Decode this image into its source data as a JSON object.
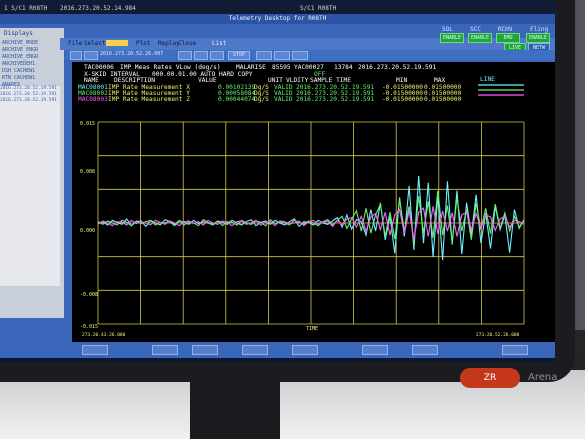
{
  "top_banner": {
    "left": "1  S/C1  R08TH",
    "mid": "2016.273.20.52.14.984",
    "right_title": "S/C1  R08TH"
  },
  "window": {
    "title": "Telemetry Desktop for R08TH"
  },
  "menubar": {
    "items": [
      "File",
      "Select",
      "",
      "Plot",
      "Replay",
      "Close"
    ],
    "highlighted_index": 2,
    "list_label": "List",
    "subtabs_label": "Subtabs",
    "stop_label": "STOP"
  },
  "sidebar": {
    "title": "Displays",
    "items": [
      "ARCHIVE_MODE",
      "ARCHIVE ENGR",
      "ARCHIVE_ENGR",
      "ARCHIVEDEH1",
      "DSH CACHEW1",
      "RTN CACHEW1",
      "ANAREX"
    ]
  },
  "status_panel": {
    "labels": [
      "SOL",
      "SCC",
      "RCHV",
      "Fling"
    ],
    "buttons": [
      "ENABLE",
      "ENABLE",
      "EMU",
      "ENABLE",
      "LIVE",
      "NETW"
    ]
  },
  "toolbar": {
    "timestamp": "2016.273.20.52.26.007"
  },
  "plot": {
    "id_left": "TAC00006",
    "title": "IMP Meas Rates VLow (deg/s)",
    "malarise": "MALARISE",
    "num1": "85595",
    "id_right": "YAC00027",
    "num2": "13784",
    "time": "2016.273.20.52.19.591",
    "line_label": "LINE",
    "off_label": "OFF",
    "row_xskid": "X-SKID INTERVAL",
    "interval": "000.00.01.00 AUTO HARD COPY",
    "hdr_name": "NAME",
    "hdr_desc": "DESCRIPTION",
    "hdr_value": "VALUE",
    "hdr_unit": "UNIT",
    "hdr_valid": "VLDITY",
    "hdr_sample": "SAMPLE TIME",
    "hdr_min": "MIN",
    "hdr_max": "MAX",
    "rows": [
      {
        "name": "MAC08001",
        "desc": "IMP Rate Measurement X",
        "value": "0.00102139",
        "unit": "Dg/S",
        "valid": "VALID",
        "time": "2016.273.20.52.19.591",
        "min": "-0.01500000",
        "max": "0.01500000",
        "color": "#6ff0ff"
      },
      {
        "name": "MAC08002",
        "desc": "IMP Rate Measurement Y",
        "value": "0.00058084",
        "unit": "Dg/S",
        "valid": "VALID",
        "time": "2016.273.20.52.19.591",
        "min": "-0.01500000",
        "max": "0.01500000",
        "color": "#66f06a"
      },
      {
        "name": "MAC08003",
        "desc": "IMP Rate Measurement Z",
        "value": "0.00044074",
        "unit": "Dg/S",
        "valid": "VALID",
        "time": "2016.273.20.52.19.591",
        "min": "-0.01500000",
        "max": "0.01500000",
        "color": "#ff5cff"
      }
    ],
    "y_ticks": [
      "0.015",
      "0.008",
      "0.000",
      "-0.008",
      "-0.015"
    ],
    "x_start": "273.20.43.26.000",
    "x_label": "TIME",
    "x_end": "273.20.52.26.000"
  },
  "chart_data": {
    "type": "line",
    "title": "IMP Meas Rates VLow (deg/s)",
    "xlabel": "TIME",
    "ylabel": "",
    "ylim": [
      -0.015,
      0.015
    ],
    "x": [
      0,
      1,
      2,
      3,
      4,
      5,
      6,
      7,
      8,
      9,
      10,
      11,
      12,
      13,
      14,
      15,
      16,
      17,
      18,
      19,
      20,
      21,
      22,
      23,
      24,
      25,
      26,
      27,
      28,
      29,
      30,
      31,
      32,
      33,
      34,
      35,
      36,
      37,
      38,
      39,
      40,
      41,
      42,
      43,
      44,
      45,
      46,
      47,
      48,
      49,
      50,
      51,
      52,
      53,
      54,
      55,
      56,
      57,
      58,
      59,
      60,
      61,
      62,
      63,
      64,
      65,
      66,
      67,
      68,
      69,
      70,
      71,
      72,
      73,
      74,
      75,
      76,
      77,
      78,
      79,
      80,
      81,
      82,
      83,
      84,
      85,
      86,
      87,
      88,
      89
    ],
    "series": [
      {
        "name": "MAC08001",
        "color": "#6ff0ff",
        "values": [
          0.0,
          0.0002,
          -0.0003,
          0.0004,
          0.0001,
          -0.0002,
          0.0006,
          -0.0004,
          0.0002,
          0.0003,
          -0.0005,
          0.0004,
          0.0,
          -0.0003,
          0.0005,
          0.0002,
          -0.0004,
          0.0003,
          0.0001,
          -0.0002,
          0.0004,
          -0.0001,
          0.0002,
          0.0,
          -0.0003,
          0.0003,
          0.0001,
          -0.0002,
          0.0004,
          0.0,
          -0.0003,
          0.0002,
          0.0005,
          -0.0004,
          0.0001,
          0.0003,
          -0.0002,
          0.0004,
          0.0,
          -0.0003,
          0.0002,
          0.0006,
          -0.0005,
          0.0002,
          0.0001,
          -0.0003,
          0.0004,
          0.0,
          -0.0002,
          0.0003,
          0.0008,
          -0.0006,
          0.0012,
          -0.0009,
          0.0005,
          0.0002,
          -0.0018,
          0.002,
          -0.0012,
          0.003,
          -0.0025,
          0.001,
          -0.0045,
          0.0038,
          -0.002,
          0.0055,
          -0.004,
          0.007,
          -0.003,
          0.006,
          -0.005,
          0.004,
          -0.0055,
          0.0062,
          -0.0032,
          0.0048,
          -0.0046,
          0.003,
          -0.0018,
          0.0042,
          -0.003,
          0.0015,
          -0.0038,
          0.0025,
          -0.001,
          0.0012,
          -0.0044,
          0.002,
          -0.0008,
          0.0005
        ]
      },
      {
        "name": "MAC08002",
        "color": "#66f06a",
        "values": [
          0.0002,
          -0.0002,
          0.0003,
          0.0,
          -0.0003,
          0.0004,
          0.0001,
          -0.0004,
          0.0003,
          -0.0001,
          0.0002,
          0.0004,
          -0.0003,
          0.0001,
          0.0,
          0.0003,
          -0.0002,
          0.0004,
          -0.0003,
          0.0002,
          0.0,
          -0.0004,
          0.0005,
          0.0001,
          -0.0002,
          0.0003,
          -0.0004,
          0.0002,
          0.0001,
          -0.0003,
          0.0004,
          0.0,
          -0.0002,
          0.0003,
          0.0001,
          -0.0004,
          0.0005,
          -0.0001,
          0.0002,
          0.0,
          -0.0003,
          0.0004,
          0.0001,
          -0.0002,
          0.0003,
          0.0,
          -0.0004,
          0.0002,
          0.0005,
          -0.0003,
          0.0004,
          0.001,
          -0.0008,
          0.0006,
          0.0018,
          -0.0012,
          0.0022,
          -0.0015,
          0.0012,
          0.0028,
          -0.002,
          0.0016,
          -0.0024,
          0.0035,
          -0.0012,
          0.0025,
          -0.003,
          0.004,
          -0.0015,
          0.0032,
          -0.0022,
          0.0048,
          -0.0018,
          0.0026,
          -0.0028,
          0.0038,
          -0.0012,
          0.002,
          -0.0025,
          0.003,
          -0.001,
          0.0022,
          -0.0016,
          0.0028,
          -0.0008,
          0.0015,
          -0.0012,
          0.001,
          -0.0006,
          0.0004
        ]
      },
      {
        "name": "MAC08003",
        "color": "#ff5cff",
        "values": [
          -0.0002,
          0.0003,
          0.0,
          -0.0004,
          0.0002,
          0.0001,
          -0.0003,
          0.0004,
          -0.0001,
          0.0002,
          0.0,
          -0.0003,
          0.0004,
          0.0001,
          -0.0002,
          0.0003,
          0.0,
          -0.0004,
          0.0002,
          0.0003,
          -0.0001,
          0.0002,
          -0.0003,
          0.0004,
          0.0,
          -0.0002,
          0.0003,
          0.0001,
          -0.0004,
          0.0002,
          0.0003,
          -0.0002,
          0.0,
          0.0004,
          -0.0003,
          0.0001,
          0.0002,
          -0.0004,
          0.0003,
          0.0002,
          -0.0001,
          0.0,
          0.0003,
          -0.0004,
          0.0002,
          0.0004,
          -0.0002,
          0.0001,
          0.0003,
          -0.0005,
          0.0004,
          -0.0003,
          0.0006,
          0.0008,
          -0.0006,
          0.001,
          -0.0012,
          0.0009,
          0.0014,
          -0.001,
          0.0016,
          -0.0018,
          0.0012,
          0.002,
          -0.0015,
          0.0018,
          -0.0024,
          0.0016,
          0.0022,
          -0.002,
          0.0025,
          -0.0016,
          0.0018,
          -0.0012,
          0.0015,
          -0.002,
          0.0012,
          0.0016,
          -0.001,
          0.0014,
          -0.0008,
          0.0012,
          0.0009,
          -0.0011,
          0.0006,
          0.001,
          -0.0006,
          0.0004,
          0.0002,
          -0.0002
        ]
      }
    ]
  },
  "brand": {
    "logo": "ZR",
    "name": "Arena"
  }
}
